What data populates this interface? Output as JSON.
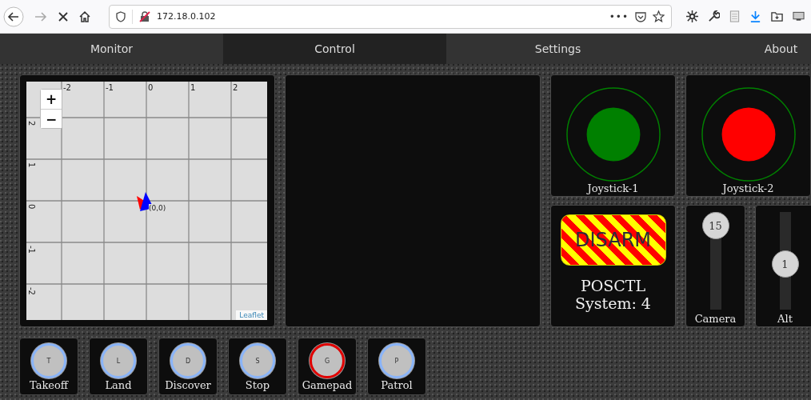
{
  "browser": {
    "url": "172.18.0.102",
    "menu": "•••"
  },
  "tabs": [
    {
      "label": "Monitor",
      "selected": false
    },
    {
      "label": "Control",
      "selected": true
    },
    {
      "label": "Settings",
      "selected": false
    },
    {
      "label": "About",
      "selected": false
    }
  ],
  "map": {
    "x_labels": [
      "-2",
      "-1",
      "0",
      "1",
      "2"
    ],
    "y_labels": [
      "2",
      "1",
      "0",
      "-1",
      "-2"
    ],
    "marker_label": "(0,0)",
    "zoom_in": "+",
    "zoom_out": "−",
    "attribution": "Leaflet"
  },
  "joysticks": [
    {
      "label": "Joystick-1",
      "color": "#008000"
    },
    {
      "label": "Joystick-2",
      "color": "#ff0000"
    }
  ],
  "mode_panel": {
    "disarm": "DISARM",
    "mode": "POSCTL",
    "system": "System: 4"
  },
  "sliders": [
    {
      "label": "Camera",
      "value": "15",
      "level": 1
    },
    {
      "label": "Alt",
      "value": "1",
      "level": 0.45
    }
  ],
  "actions": [
    {
      "letter": "T",
      "label": "Takeoff",
      "active": false
    },
    {
      "letter": "L",
      "label": "Land",
      "active": false
    },
    {
      "letter": "D",
      "label": "Discover",
      "active": false
    },
    {
      "letter": "S",
      "label": "Stop",
      "active": false
    },
    {
      "letter": "G",
      "label": "Gamepad",
      "active": true
    },
    {
      "letter": "P",
      "label": "Patrol",
      "active": false
    }
  ]
}
